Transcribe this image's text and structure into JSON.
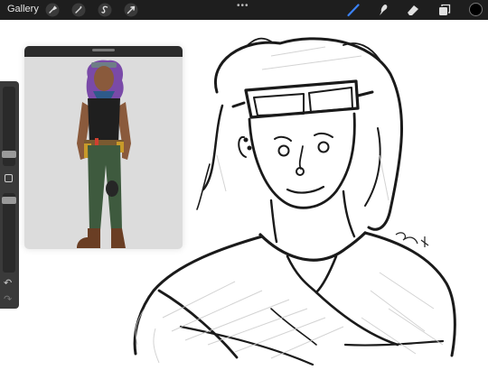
{
  "toolbar": {
    "gallery_label": "Gallery",
    "more_label": "•••",
    "left_tools": [
      {
        "name": "actions-icon"
      },
      {
        "name": "adjustments-icon"
      },
      {
        "name": "selection-icon"
      },
      {
        "name": "transform-icon"
      }
    ],
    "right_tools": [
      {
        "name": "brush-icon",
        "active": true
      },
      {
        "name": "smudge-icon",
        "active": false
      },
      {
        "name": "eraser-icon",
        "active": false
      },
      {
        "name": "layers-icon",
        "active": false
      }
    ],
    "active_color": "#000000",
    "accent_color": "#3b82f6"
  },
  "sidebar": {
    "modify_icon": "square-modify-icon",
    "undo_icon": "undo-icon",
    "redo_icon": "redo-icon"
  },
  "reference_window": {
    "title": ""
  },
  "colors": {
    "toolbar_bg": "#1e1e1e",
    "canvas_bg": "#ffffff",
    "sidebar_bg": "#3a3a3a"
  }
}
